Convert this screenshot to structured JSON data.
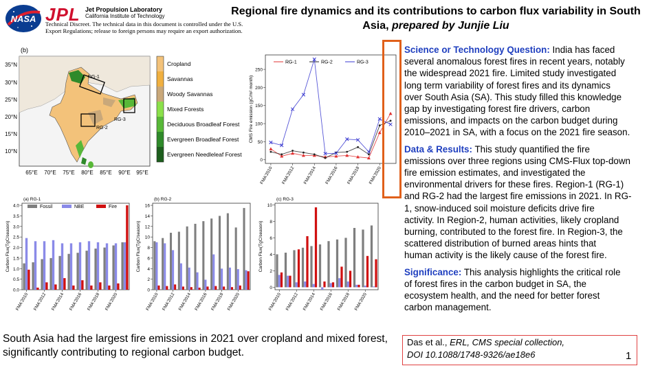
{
  "header": {
    "logo_nasa": "NASA",
    "logo_jpl": "JPL",
    "lab_name": "Jet Propulsion Laboratory",
    "lab_institute": "California Institute of Technology",
    "disclaimer": "Technical Discreet. The technical data in this document is controlled under the U.S. Export Regulations; release to foreign persons may require an export authorization."
  },
  "title": {
    "main": "Regional fire dynamics and its contributions to carbon flux variability in South Asia, ",
    "author": "prepared by Junjie Liu"
  },
  "map": {
    "panel_label": "(b)",
    "lat_ticks": [
      "35°N",
      "30°N",
      "25°N",
      "20°N",
      "15°N",
      "10°N"
    ],
    "lon_ticks": [
      "65°E",
      "70°E",
      "75°E",
      "80°E",
      "85°E",
      "90°E",
      "95°E"
    ],
    "region_labels": [
      "RG-1",
      "RG-2",
      "RG-3"
    ],
    "legend": [
      {
        "label": "Cropland",
        "color": "#f3c27a"
      },
      {
        "label": "Savannas",
        "color": "#f0b040"
      },
      {
        "label": "Woody Savannas",
        "color": "#c9a87a"
      },
      {
        "label": "Mixed Forests",
        "color": "#8be04a"
      },
      {
        "label": "Deciduous Broadleaf Forest",
        "color": "#58b838"
      },
      {
        "label": "Evergreen Broadleaf Forest",
        "color": "#2f8a2a"
      },
      {
        "label": "Evergreen Needleleaf Forest",
        "color": "#1d5e1d"
      }
    ]
  },
  "text": {
    "q_head": "Science or Technology Question:",
    "q_lines": [
      " India has faced",
      "several anomalous forest fires in recent years, notably",
      "the widespread 2021 fire. Limited study investigated",
      "long term variability of forest fires and its dynamics",
      "over South Asia (SA).  This study filled this knowledge",
      "gap by investigating forest fire drivers, carbon",
      "emissions, and impacts on the carbon budget during",
      "2010–2021 in SA, with a focus on the 2021 fire season."
    ],
    "d_head": "Data & Results:",
    "d_lines": [
      " This study quantified the fire",
      "emissions over three regions using CMS-Flux top-down",
      "fire emission estimates, and investigated the",
      "environmental drivers for these fires.  Region-1 (RG-1)",
      "and RG-2 had the largest fire emissions in 2021. In RG-",
      "1, snow-induced soil moisture deficits drive fire",
      "activity. In Region-2, human activities, likely cropland",
      "burning, contributed to the forest fire. In Region-3, the",
      "scattered distribution of burned areas hints that",
      "human activity is the likely cause of the forest fire."
    ],
    "s_head": "Significance:",
    "s_lines": [
      " This analysis highlights the critical role",
      "of forest fires in the carbon budget in SA, the",
      "ecosystem health, and the need for better forest",
      "carbon management."
    ]
  },
  "summary": "South Asia had the largest fire emissions in 2021 over cropland and mixed forest, significantly contributing to regional carbon budget.",
  "citation": {
    "line1_a": "Das et al., ",
    "line1_b": "ERL, CMS special collection,",
    "line2": "DOI 10.1088/1748-9326/ae18e6"
  },
  "page_number": "1",
  "chart_data": [
    {
      "type": "line",
      "ylabel": "CMS Fire emission (gC/m² month)",
      "x": [
        "FMA'2010",
        "FMA'2011",
        "FMA'2012",
        "FMA'2013",
        "FMA'2014",
        "FMA'2015",
        "FMA'2016",
        "FMA'2017",
        "FMA'2018",
        "FMA'2019",
        "FMA'2020",
        "FMA'2021"
      ],
      "xticks": [
        "FMA'2010",
        "FMA'2012",
        "FMA'2014",
        "FMA'2016",
        "FMA'2018",
        "FMA'2020"
      ],
      "yticks": [
        0,
        50,
        100,
        150,
        200,
        250
      ],
      "ylim": [
        -10,
        290
      ],
      "legend_position": "top",
      "colors": [
        "#e03030",
        "#222222",
        "#3a3ad0"
      ],
      "series": [
        {
          "name": "RG-1",
          "values": [
            30,
            10,
            18,
            12,
            12,
            8,
            10,
            12,
            8,
            5,
            75,
            128
          ]
        },
        {
          "name": "RG-2",
          "values": [
            22,
            15,
            25,
            20,
            15,
            5,
            20,
            22,
            35,
            15,
            95,
            108
          ]
        },
        {
          "name": "RG-3",
          "values": [
            48,
            40,
            140,
            180,
            278,
            17,
            18,
            57,
            55,
            22,
            113,
            98
          ]
        }
      ]
    },
    {
      "type": "bar",
      "panel_label": "(a) RG-1",
      "ylabel": "Carbon Flux(TgC/season)",
      "categories": [
        "FMA'2010",
        "FMA'2011",
        "FMA'2012",
        "FMA'2013",
        "FMA'2014",
        "FMA'2015",
        "FMA'2016",
        "FMA'2017",
        "FMA'2018",
        "FMA'2019",
        "FMA'2020",
        "FMA'2021"
      ],
      "xticks": [
        "FMA'2010",
        "FMA'2012",
        "FMA'2014",
        "FMA'2016",
        "FMA'2018",
        "FMA'2020"
      ],
      "yticks": [
        0.0,
        0.5,
        1.0,
        1.5,
        2.0,
        2.5,
        3.0,
        3.5,
        4.0
      ],
      "ylim": [
        0,
        4.1
      ],
      "legend_position": "top",
      "colors": [
        "#7f7f7f",
        "#8a8ae8",
        "#d01010"
      ],
      "series": [
        {
          "name": "Fossil",
          "values": [
            1.25,
            1.3,
            1.45,
            1.5,
            1.6,
            1.7,
            1.75,
            1.85,
            1.95,
            2.0,
            2.1,
            2.25
          ]
        },
        {
          "name": "NBE",
          "values": [
            2.45,
            2.3,
            2.3,
            2.35,
            2.2,
            2.2,
            2.25,
            2.3,
            2.25,
            2.2,
            2.2,
            2.25
          ]
        },
        {
          "name": "Fire",
          "values": [
            0.95,
            0.1,
            0.35,
            0.25,
            0.55,
            0.2,
            0.45,
            0.2,
            0.35,
            0.2,
            0.3,
            4.0
          ]
        }
      ]
    },
    {
      "type": "bar",
      "panel_label": "(b) RG-2",
      "ylabel": "Carbon Flux(TgC/season)",
      "categories": [
        "FMA'2010",
        "FMA'2011",
        "FMA'2012",
        "FMA'2013",
        "FMA'2014",
        "FMA'2015",
        "FMA'2016",
        "FMA'2017",
        "FMA'2018",
        "FMA'2019",
        "FMA'2020",
        "FMA'2021"
      ],
      "xticks": [
        "FMA'2010",
        "FMA'2012",
        "FMA'2014",
        "FMA'2016",
        "FMA'2018",
        "FMA'2020"
      ],
      "yticks": [
        0,
        2,
        4,
        6,
        8,
        10,
        12,
        14,
        16
      ],
      "ylim": [
        0,
        16.4
      ],
      "colors": [
        "#7f7f7f",
        "#8a8ae8",
        "#d01010"
      ],
      "series": [
        {
          "name": "Fossil",
          "values": [
            9.2,
            9.8,
            10.8,
            11.0,
            12.0,
            12.5,
            13.0,
            13.5,
            14.0,
            14.5,
            11.8,
            15.5
          ]
        },
        {
          "name": "NBE",
          "values": [
            9.0,
            8.8,
            7.5,
            5.0,
            4.2,
            3.3,
            1.9,
            6.7,
            4.0,
            4.2,
            3.9,
            3.7
          ]
        },
        {
          "name": "Fire",
          "values": [
            0.8,
            0.7,
            1.0,
            0.6,
            0.5,
            0.4,
            0.6,
            0.7,
            0.6,
            0.5,
            0.8,
            3.5
          ]
        }
      ]
    },
    {
      "type": "bar",
      "panel_label": "(c) RG-3",
      "ylabel": "Carbon Flux(TgC/season)",
      "categories": [
        "FMA'2010",
        "FMA'2011",
        "FMA'2012",
        "FMA'2013",
        "FMA'2014",
        "FMA'2015",
        "FMA'2016",
        "FMA'2017",
        "FMA'2018",
        "FMA'2019",
        "FMA'2020",
        "FMA'2021"
      ],
      "xticks": [
        "FMA'2010",
        "FMA'2012",
        "FMA'2014",
        "FMA'2016",
        "FMA'2018",
        "FMA'2020"
      ],
      "yticks": [
        0,
        2,
        4,
        6,
        8,
        10
      ],
      "ylim": [
        -0.3,
        10.2
      ],
      "colors": [
        "#7f7f7f",
        "#8a8ae8",
        "#d01010"
      ],
      "series": [
        {
          "name": "Fossil",
          "values": [
            4.0,
            4.2,
            4.5,
            4.8,
            5.0,
            5.2,
            5.6,
            5.8,
            6.0,
            7.2,
            7.0,
            7.5
          ]
        },
        {
          "name": "NBE",
          "values": [
            1.5,
            1.4,
            0.6,
            0.7,
            0.4,
            -0.3,
            0.5,
            1.1,
            0.7,
            0.3,
            0.2,
            0.1
          ]
        },
        {
          "name": "Fire",
          "values": [
            1.8,
            1.4,
            4.6,
            6.2,
            9.7,
            0.7,
            0.6,
            2.5,
            2.0,
            0.3,
            3.8,
            3.4
          ]
        }
      ]
    }
  ]
}
